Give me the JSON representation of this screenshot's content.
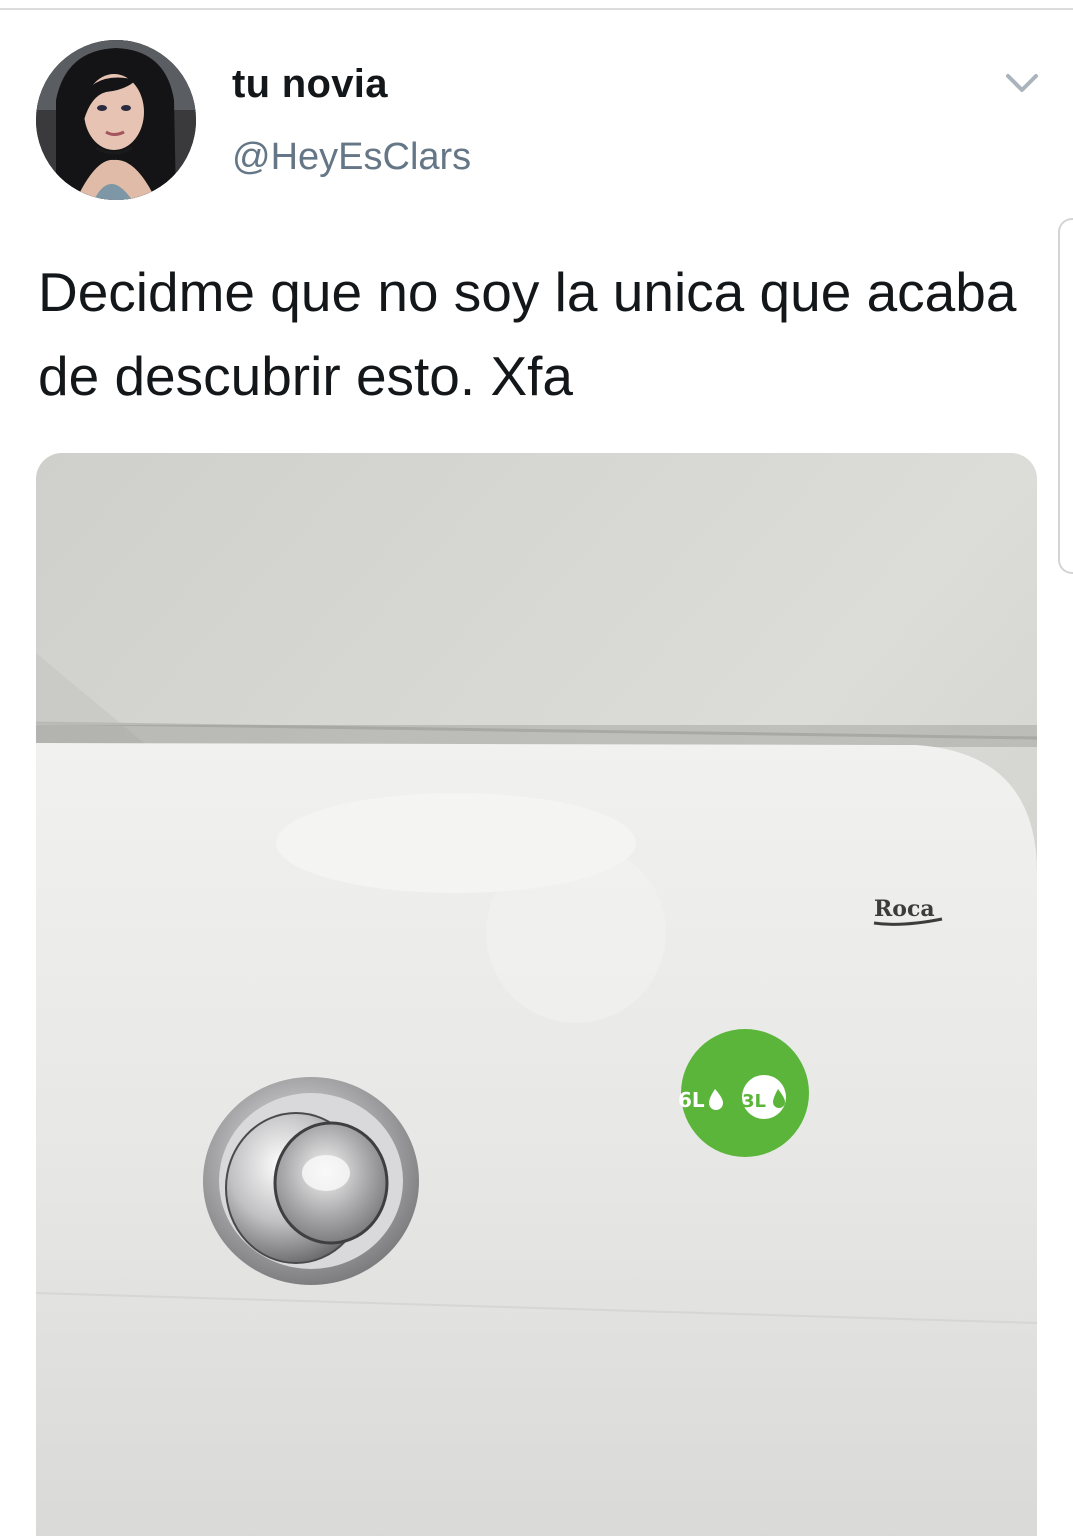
{
  "tweet": {
    "author": {
      "display_name": "tu novia",
      "handle": "@HeyEsClars",
      "avatar_icon": "profile-photo"
    },
    "menu_icon": "chevron-down-icon",
    "text": "Decidme que no soy la unica que acaba de descubrir esto. Xfa",
    "media": {
      "brand_logo": "Roca",
      "badge": {
        "full": "6L",
        "half": "3L",
        "color": "#5bb53a"
      }
    }
  },
  "colors": {
    "text": "#14171a",
    "secondary_text": "#657786",
    "background": "#ffffff"
  }
}
